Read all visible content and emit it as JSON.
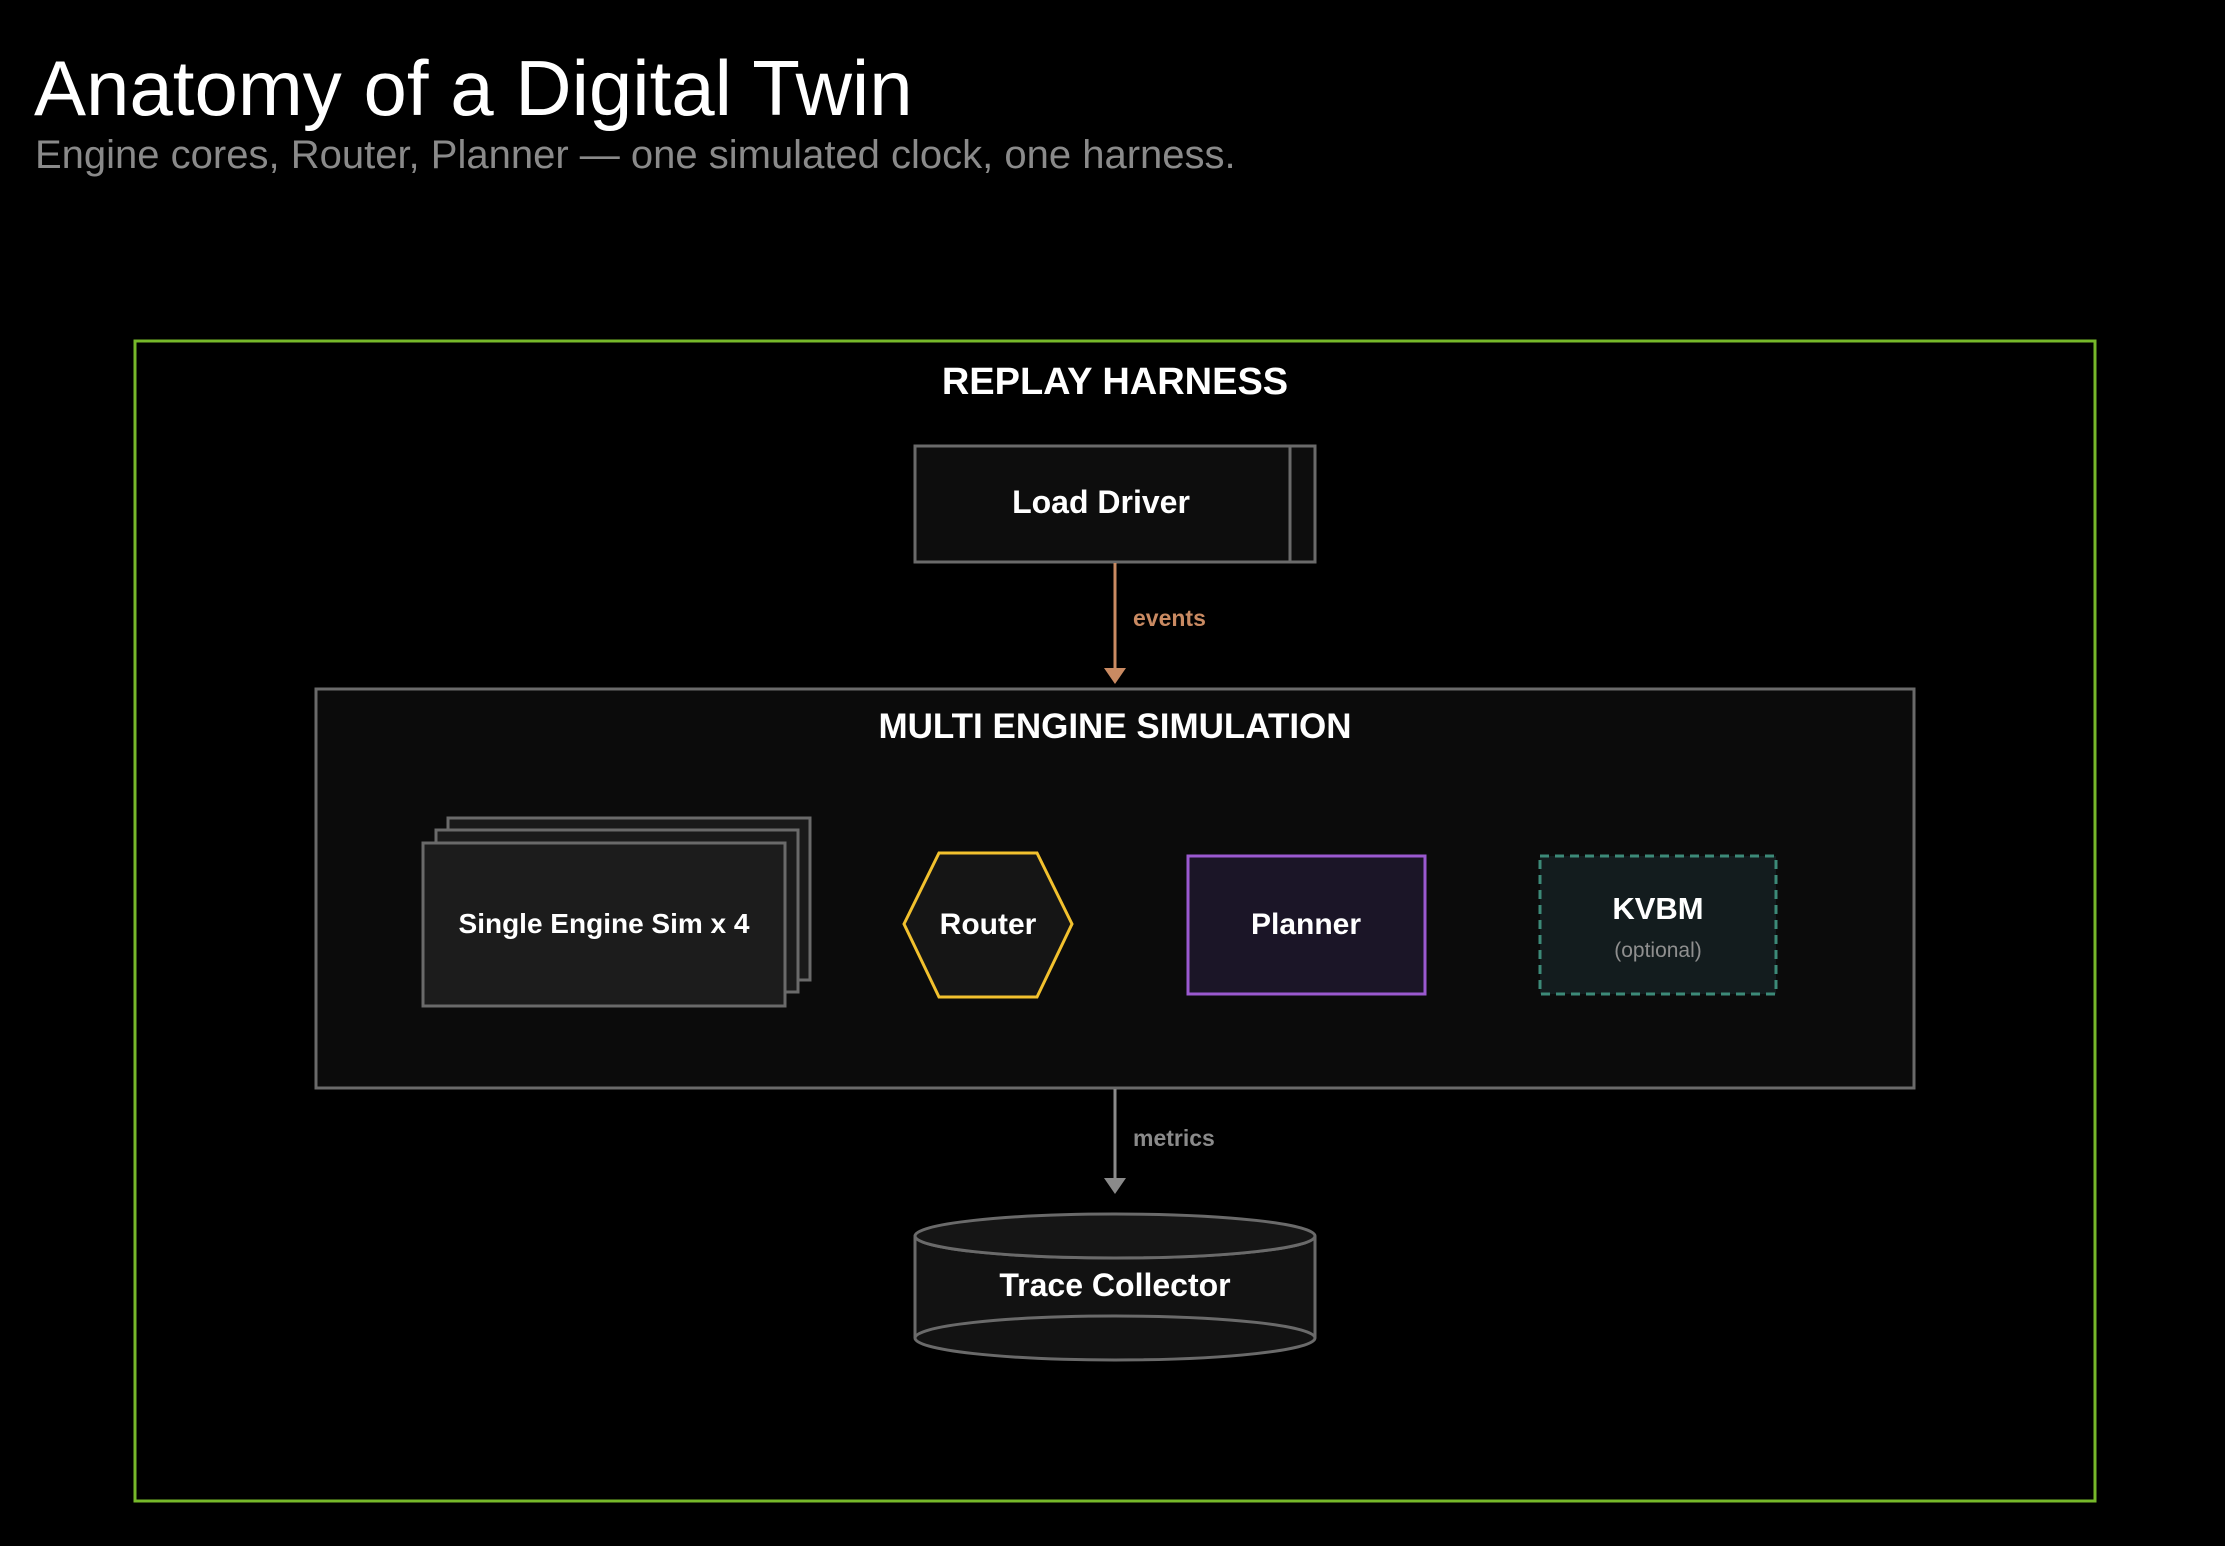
{
  "header": {
    "title": "Anatomy of a Digital Twin",
    "subtitle": "Engine cores, Router, Planner — one simulated clock, one harness."
  },
  "diagram": {
    "harness": {
      "label": "REPLAY HARNESS",
      "border_color": "#76b82a"
    },
    "load_driver": {
      "label": "Load Driver"
    },
    "edge_events": {
      "label": "events",
      "color": "#c98a62"
    },
    "simulation": {
      "label": "MULTI ENGINE SIMULATION"
    },
    "engine_sim": {
      "label": "Single Engine Sim x 4"
    },
    "router": {
      "label": "Router",
      "border_color": "#f2c12e"
    },
    "planner": {
      "label": "Planner",
      "border_color": "#9b59d0"
    },
    "kvbm": {
      "label": "KVBM",
      "note": "(optional)",
      "border_color": "#3c8a78"
    },
    "edge_metrics": {
      "label": "metrics",
      "color": "#8a8a8a"
    },
    "trace_collector": {
      "label": "Trace Collector"
    }
  }
}
